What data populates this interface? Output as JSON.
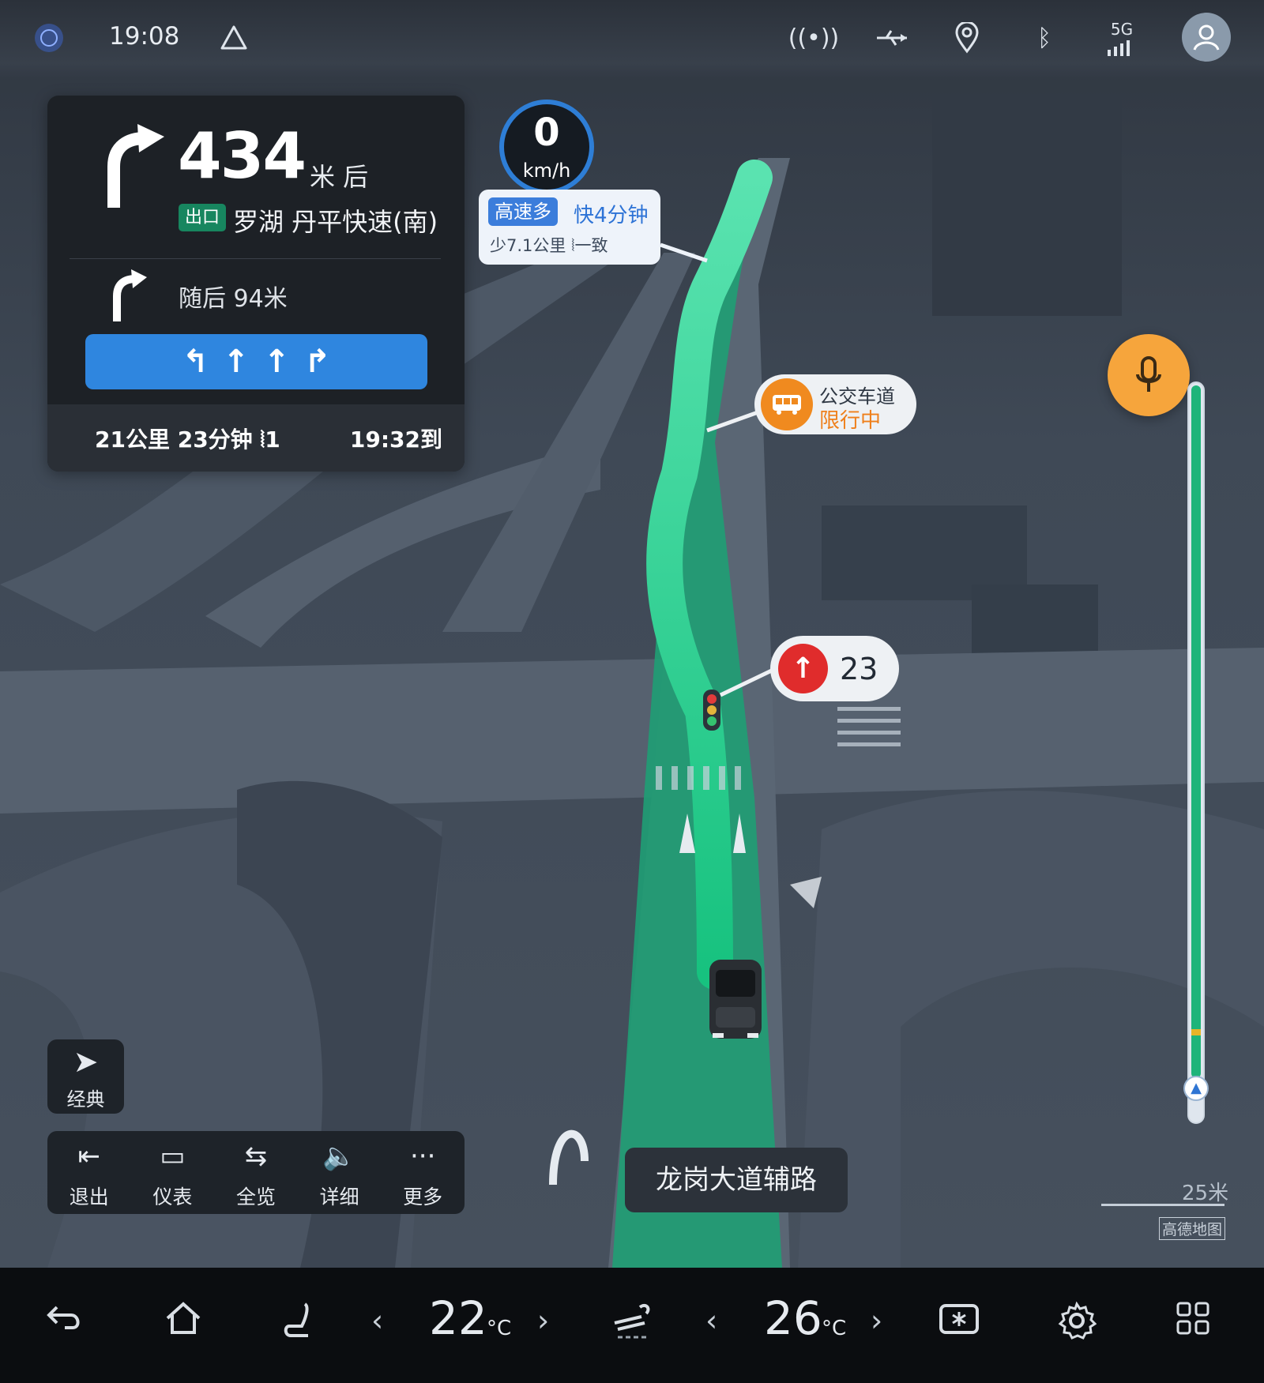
{
  "status_bar": {
    "time": "19:08",
    "icons": [
      "avatar-globe-icon",
      "warning-triangle-icon",
      "hotspot-icon",
      "usb-icon",
      "location-pin-icon",
      "bluetooth-icon",
      "signal-5g-icon",
      "user-avatar-icon"
    ],
    "signal_label": "5G"
  },
  "guidance": {
    "distance": "434",
    "distance_unit": "米 后",
    "exit_badge": "出口",
    "exit_road": "罗湖 丹平快速(南)",
    "next_text": "随后 94米",
    "lanes": [
      {
        "symbol": "↰",
        "highlight": true
      },
      {
        "symbol": "↑",
        "highlight": true
      },
      {
        "symbol": "↑",
        "highlight": true
      },
      {
        "symbol": "↱",
        "highlight": true
      }
    ],
    "remaining": "21公里  23分钟  ⦚1",
    "eta": "19:32到"
  },
  "speed": {
    "value": "0",
    "unit": "km/h"
  },
  "route_bubble": {
    "tag": "高速多",
    "faster": "快4分钟",
    "sub": "少7.1公里 ⦚一致"
  },
  "bus_lane": {
    "line1": "公交车道",
    "line2": "限行中"
  },
  "traffic_light": {
    "count": "23"
  },
  "progress": {
    "fraction_done": 0.04,
    "marker_fraction": 0.88
  },
  "mode_button": {
    "label": "经典"
  },
  "toolbar": [
    {
      "icon": "exit-icon",
      "glyph": "⇤",
      "label": "退出"
    },
    {
      "icon": "dashboard-icon",
      "glyph": "▭",
      "label": "仪表"
    },
    {
      "icon": "overview-icon",
      "glyph": "⇆",
      "label": "全览"
    },
    {
      "icon": "speaker-icon",
      "glyph": "🔈",
      "label": "详细"
    },
    {
      "icon": "more-icon",
      "glyph": "···",
      "label": "更多"
    }
  ],
  "road_name": "龙岗大道辅路",
  "scale": {
    "label": "25米"
  },
  "brand": "高德地图",
  "dock": {
    "temp_left": "22",
    "temp_right": "26",
    "temp_unit": "°C"
  },
  "colors": {
    "route_green": "#1fc98a",
    "accent_blue": "#2f86df",
    "bus_orange": "#f08a1f",
    "light_red": "#e02c2c",
    "mic_orange": "#f6a53c"
  }
}
